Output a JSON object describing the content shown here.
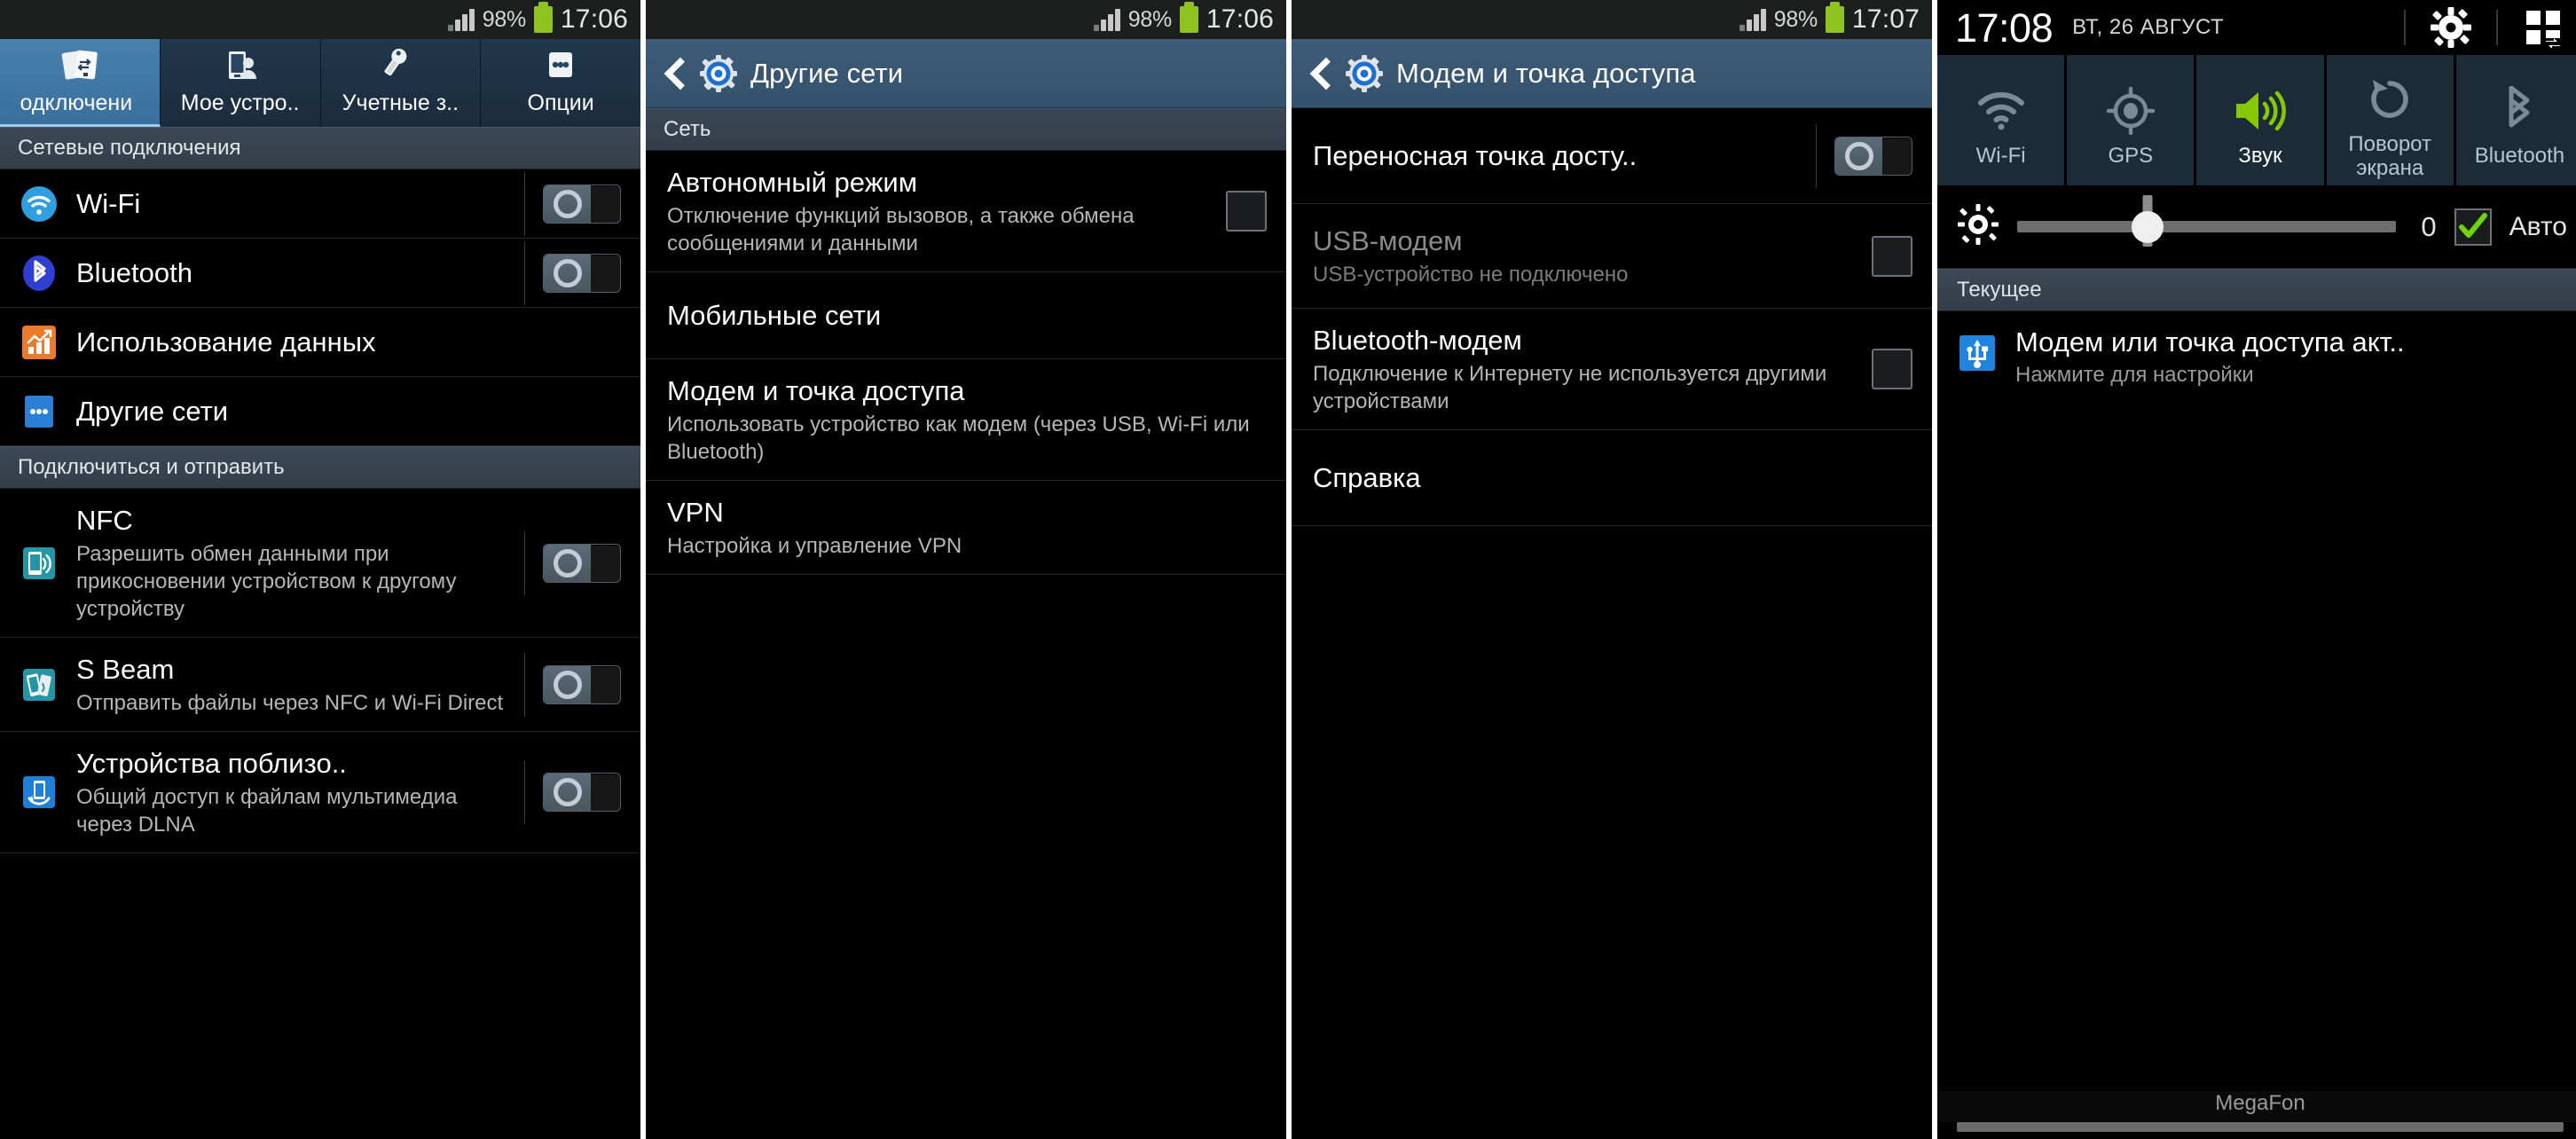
{
  "panel1": {
    "statusbar": {
      "battery_percent": "98%",
      "time": "17:06"
    },
    "tabs": [
      {
        "label": "одключени",
        "icon": "connections-icon",
        "active": true
      },
      {
        "label": "Мое устро..",
        "icon": "my-device-icon",
        "active": false
      },
      {
        "label": "Учетные з..",
        "icon": "accounts-icon",
        "active": false
      },
      {
        "label": "Опции",
        "icon": "more-options-icon",
        "active": false
      }
    ],
    "sections": [
      {
        "header": "Сетевые подключения",
        "rows": [
          {
            "title": "Wi-Fi",
            "sub": "",
            "icon": "wifi-icon",
            "control": "toggle",
            "toggle_state": "off"
          },
          {
            "title": "Bluetooth",
            "sub": "",
            "icon": "bluetooth-icon",
            "control": "toggle",
            "toggle_state": "off"
          },
          {
            "title": "Использование данных",
            "sub": "",
            "icon": "data-usage-icon",
            "control": "none"
          },
          {
            "title": "Другие сети",
            "sub": "",
            "icon": "more-networks-icon",
            "control": "none"
          }
        ]
      },
      {
        "header": "Подключиться и отправить",
        "rows": [
          {
            "title": "NFC",
            "sub": "Разрешить обмен данными при прикосновении устройством к другому устройству",
            "icon": "nfc-icon",
            "control": "toggle",
            "toggle_state": "off"
          },
          {
            "title": "S Beam",
            "sub": "Отправить файлы через NFC и Wi-Fi Direct",
            "icon": "s-beam-icon",
            "control": "toggle",
            "toggle_state": "off"
          },
          {
            "title": "Устройства поблизо..",
            "sub": "Общий доступ к файлам мультимедиа через DLNA",
            "icon": "nearby-devices-icon",
            "control": "toggle",
            "toggle_state": "off"
          }
        ]
      }
    ]
  },
  "panel2": {
    "statusbar": {
      "battery_percent": "98%",
      "time": "17:06"
    },
    "actionbar": {
      "title": "Другие сети",
      "back": "back-icon",
      "app_icon": "settings-gear-icon"
    },
    "section_header": "Сеть",
    "rows": [
      {
        "title": "Автономный режим",
        "sub": "Отключение функций вызовов, а также обмена сообщениями и данными",
        "control": "checkbox",
        "checked": false
      },
      {
        "title": "Мобильные сети",
        "sub": "",
        "control": "none"
      },
      {
        "title": "Модем и точка доступа",
        "sub": "Использовать устройство как модем (через USB, Wi-Fi или Bluetooth)",
        "control": "none"
      },
      {
        "title": "VPN",
        "sub": "Настройка и управление VPN",
        "control": "none"
      }
    ]
  },
  "panel3": {
    "statusbar": {
      "battery_percent": "98%",
      "time": "17:07"
    },
    "actionbar": {
      "title": "Модем и точка доступа",
      "back": "back-icon",
      "app_icon": "settings-gear-icon"
    },
    "rows": [
      {
        "title": "Переносная точка досту..",
        "sub": "",
        "control": "toggle",
        "toggle_state": "off",
        "dimmed": false
      },
      {
        "title": "USB-модем",
        "sub": "USB-устройство не подключено",
        "control": "checkbox",
        "checked": false,
        "dimmed": true
      },
      {
        "title": "Bluetooth-модем",
        "sub": "Подключение к Интернету не используется другими устройствами",
        "control": "checkbox",
        "checked": false,
        "dimmed": false
      },
      {
        "title": "Справка",
        "sub": "",
        "control": "none",
        "dimmed": false
      }
    ]
  },
  "panel4": {
    "statusbar": {
      "time": "17:08",
      "date": "ВТ, 26 АВГУСТ",
      "settings_icon": "gear-icon",
      "edit_icon": "quick-toggles-edit-icon"
    },
    "tiles": [
      {
        "label": "Wi-Fi",
        "icon": "wifi-icon",
        "state": "off"
      },
      {
        "label": "GPS",
        "icon": "gps-icon",
        "state": "off"
      },
      {
        "label": "Звук",
        "icon": "sound-icon",
        "state": "on"
      },
      {
        "label": "Поворот экрана",
        "icon": "screen-rotation-icon",
        "state": "off"
      },
      {
        "label": "Bluetooth",
        "icon": "bluetooth-icon",
        "state": "off"
      }
    ],
    "brightness": {
      "icon": "brightness-icon",
      "value": "0",
      "auto_label": "Авто",
      "auto_checked": true,
      "slider_percent": 34.5
    },
    "section_header": "Текущее",
    "notification": {
      "title": "Модем или точка доступа акт..",
      "sub": "Нажмите для настройки",
      "icon": "usb-tethering-icon"
    },
    "carrier": "MegaFon"
  },
  "colors": {
    "accent_blue": "#4880ae",
    "header_blue": "#3d5c79",
    "tile_bg": "#1b2b38",
    "sound_green": "#8fc800",
    "battery_green": "#8fc31f",
    "wifi_blue": "#29a3e0",
    "bluetooth_blue": "#2a4ad0",
    "data_orange": "#e8762c",
    "nfc_teal": "#2a9aa8",
    "nearby_blue": "#1d7fd6"
  }
}
